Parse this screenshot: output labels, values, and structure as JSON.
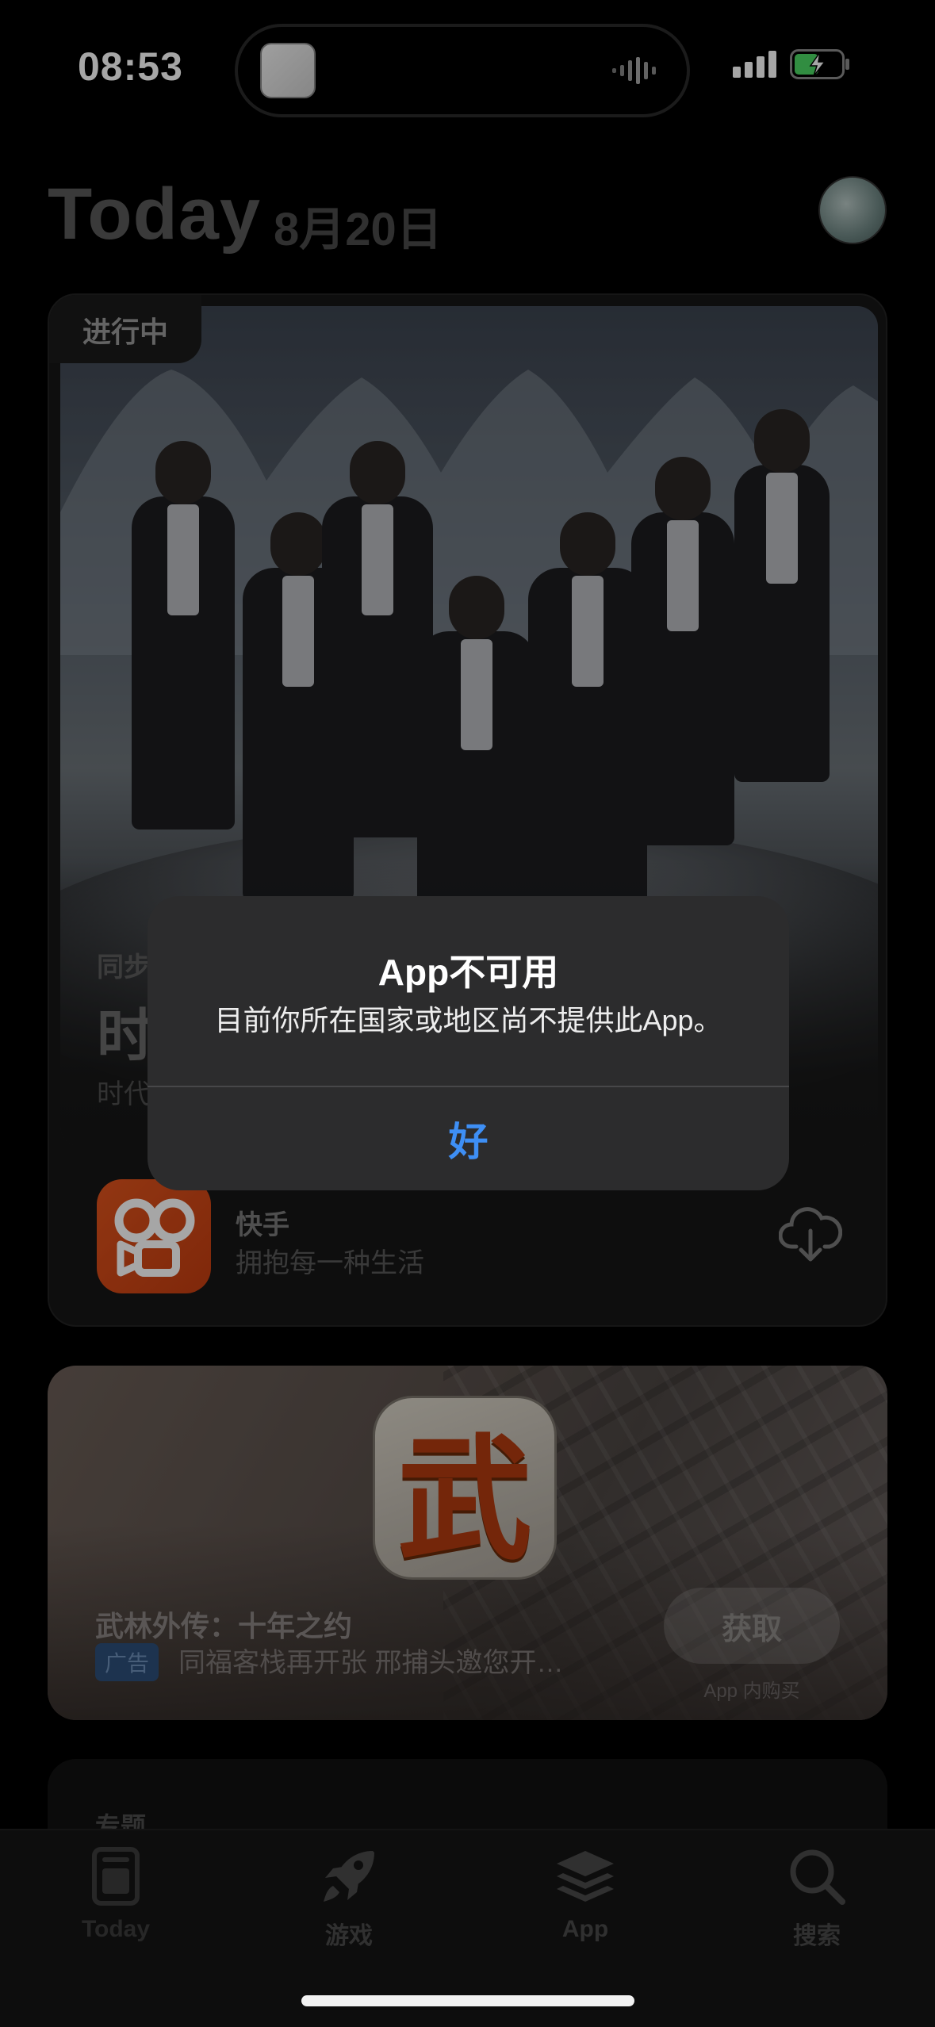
{
  "status_bar": {
    "time": "08:53"
  },
  "header": {
    "title": "Today",
    "date": "8月20日"
  },
  "card_feature": {
    "badge": "进行中",
    "subtitle": "同步",
    "title": "时",
    "description": "时代",
    "app": {
      "name": "快手",
      "tagline": "拥抱每一种生活"
    }
  },
  "card_ad": {
    "icon_char": "武",
    "game_title": "武林外传：十年之约",
    "ad_label": "广告",
    "ad_text": "同福客栈再开张 邢捕头邀您开…",
    "get_label": "获取",
    "iap_note": "App 内购买"
  },
  "card_topic": {
    "label": "专题"
  },
  "tab_bar": {
    "items": [
      {
        "label": "Today",
        "icon": "today-icon"
      },
      {
        "label": "游戏",
        "icon": "rocket-icon"
      },
      {
        "label": "App",
        "icon": "layers-icon"
      },
      {
        "label": "搜索",
        "icon": "search-icon"
      }
    ],
    "active": "Today"
  },
  "alert": {
    "title": "App不可用",
    "message": "目前你所在国家或地区尚不提供此App。",
    "button": "好"
  },
  "colors": {
    "accent": "#3e8ff5",
    "app_icon": "#e0541d",
    "battery": "#4cd964"
  }
}
